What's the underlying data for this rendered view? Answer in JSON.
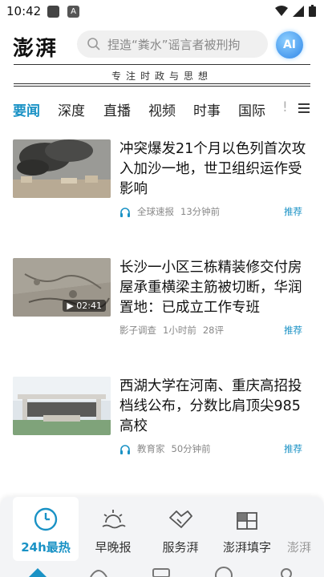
{
  "status": {
    "time": "10:42",
    "badge": "A"
  },
  "header": {
    "logo": "澎湃",
    "search_placeholder": "捏造“粪水”谣言者被刑拘",
    "ai_label": "AI"
  },
  "slogan": "专注时政与思想",
  "tabs": [
    {
      "label": "要闻",
      "active": true
    },
    {
      "label": "深度"
    },
    {
      "label": "直播"
    },
    {
      "label": "视频"
    },
    {
      "label": "时事"
    },
    {
      "label": "国际"
    },
    {
      "label": "!"
    }
  ],
  "articles": [
    {
      "title": "冲突爆发21个月以色列首次攻入加沙一地，世卫组织运作受影响",
      "source": "全球速报",
      "time": "13分钟前",
      "comments": "",
      "tag": "推荐",
      "duration": ""
    },
    {
      "title": "长沙一小区三栋精装修交付房屋承重横梁主筋被切断，华润置地：已成立工作专班",
      "source": "影子调查",
      "time": "1小时前",
      "comments": "28评",
      "tag": "推荐",
      "duration": "02:41"
    },
    {
      "title": "西湖大学在河南、重庆高招投档线公布，分数比肩顶尖985高校",
      "source": "教育家",
      "time": "50分钟前",
      "comments": "",
      "tag": "推荐",
      "duration": ""
    }
  ],
  "bottom_panel": [
    {
      "label": "24h最热",
      "icon": "clock-icon",
      "active": true
    },
    {
      "label": "早晚报",
      "icon": "sunrise-icon"
    },
    {
      "label": "服务湃",
      "icon": "handshake-icon"
    },
    {
      "label": "澎湃填字",
      "icon": "crossword-icon"
    },
    {
      "label": "澎湃",
      "icon": "more-icon"
    }
  ],
  "colors": {
    "accent": "#1a92c5",
    "text": "#111111",
    "meta": "#888888"
  }
}
